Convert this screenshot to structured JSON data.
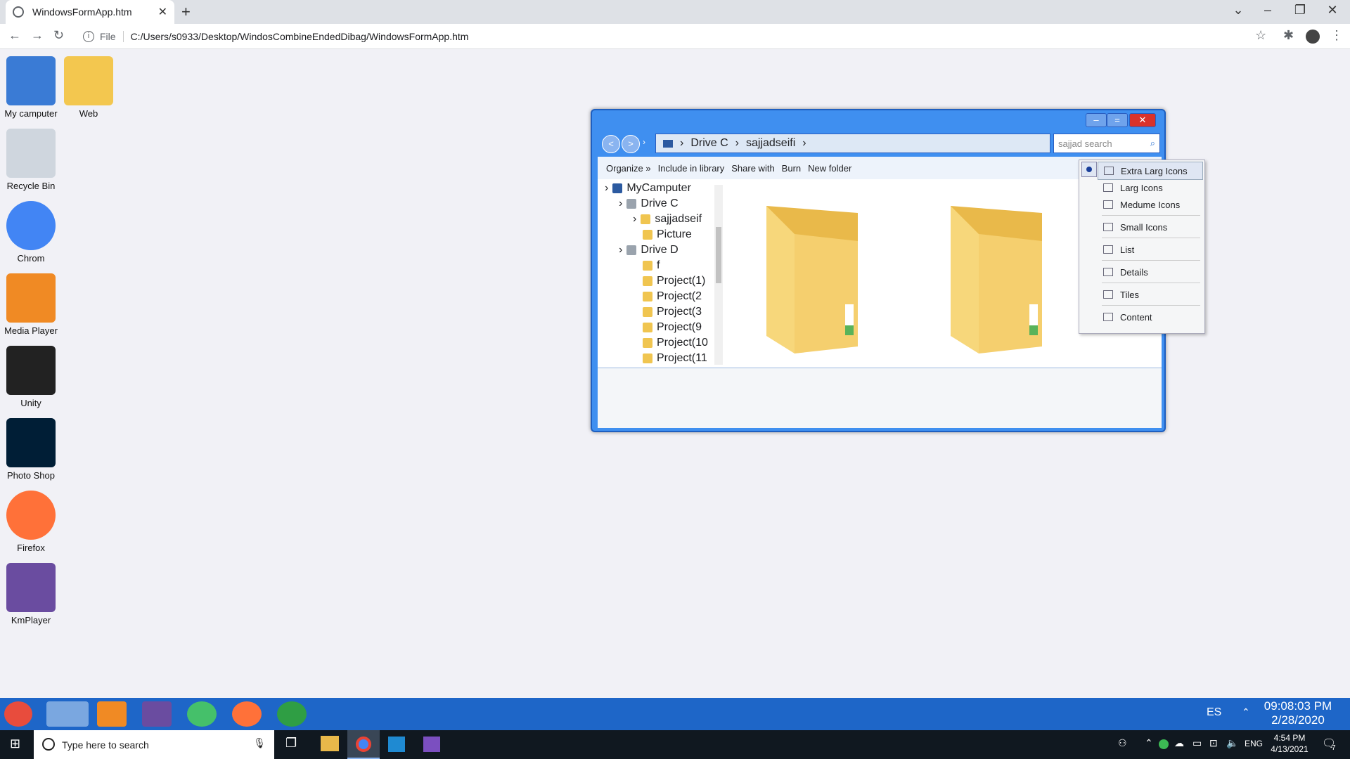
{
  "browser": {
    "tab_title": "WindowsFormApp.htm",
    "file_label": "File",
    "url": "C:/Users/s0933/Desktop/WindosCombineEndedDibag/WindowsFormApp.htm"
  },
  "desktop_icons": [
    {
      "label": "My camputer",
      "icon": "computer-icon",
      "color": "#3a7bd5"
    },
    {
      "label": "Web",
      "icon": "folder-icon",
      "color": "#f3c74f"
    },
    {
      "label": "Recycle Bin",
      "icon": "recycle-bin-icon",
      "color": "#cfd6de"
    },
    {
      "label": "Chrom",
      "icon": "chrome-icon",
      "color": "#4285f4"
    },
    {
      "label": "Media Player",
      "icon": "media-player-icon",
      "color": "#f08a24"
    },
    {
      "label": "Unity",
      "icon": "unity-icon",
      "color": "#222222"
    },
    {
      "label": "Photo Shop",
      "icon": "photoshop-icon",
      "color": "#001e36"
    },
    {
      "label": "Firefox",
      "icon": "firefox-icon",
      "color": "#ff7139"
    },
    {
      "label": "KmPlayer",
      "icon": "kmplayer-icon",
      "color": "#6a4ca0"
    }
  ],
  "explorer": {
    "breadcrumb": [
      "Drive C",
      "sajjadseifi"
    ],
    "search_placeholder": "sajjad search",
    "toolbar": [
      "Organize »",
      "Include in library",
      "Share with",
      "Burn",
      "New folder"
    ],
    "tree": [
      {
        "label": "MyCamputer",
        "level": 0,
        "icon": "computer-icon"
      },
      {
        "label": "Drive C",
        "level": 1,
        "icon": "drive-icon"
      },
      {
        "label": "sajjadseif",
        "level": 2,
        "icon": "folder-icon"
      },
      {
        "label": "Picture",
        "level": 2,
        "icon": "folder-icon"
      },
      {
        "label": "Drive D",
        "level": 1,
        "icon": "drive-icon"
      },
      {
        "label": "f",
        "level": 2,
        "icon": "folder-icon"
      },
      {
        "label": "Project(1)",
        "level": 2,
        "icon": "folder-icon"
      },
      {
        "label": "Project(2",
        "level": 2,
        "icon": "folder-icon"
      },
      {
        "label": "Project(3",
        "level": 2,
        "icon": "folder-icon"
      },
      {
        "label": "Project(9",
        "level": 2,
        "icon": "folder-icon"
      },
      {
        "label": "Project(10",
        "level": 2,
        "icon": "folder-icon"
      },
      {
        "label": "Project(11",
        "level": 2,
        "icon": "folder-icon"
      }
    ]
  },
  "view_menu": {
    "selected": "Extra Larg Icons",
    "items": [
      "Extra Larg Icons",
      "Larg Icons",
      "Medume Icons",
      "Small Icons",
      "List",
      "Details",
      "Tiles",
      "Content"
    ]
  },
  "taskbar_top": {
    "lang": "ES",
    "time": "09:08:03 PM",
    "date": "2/28/2020"
  },
  "taskbar_bottom": {
    "search_placeholder": "Type here to search",
    "lang": "ENG",
    "time": "4:54 PM",
    "date": "4/13/2021",
    "notification_count": "7"
  }
}
